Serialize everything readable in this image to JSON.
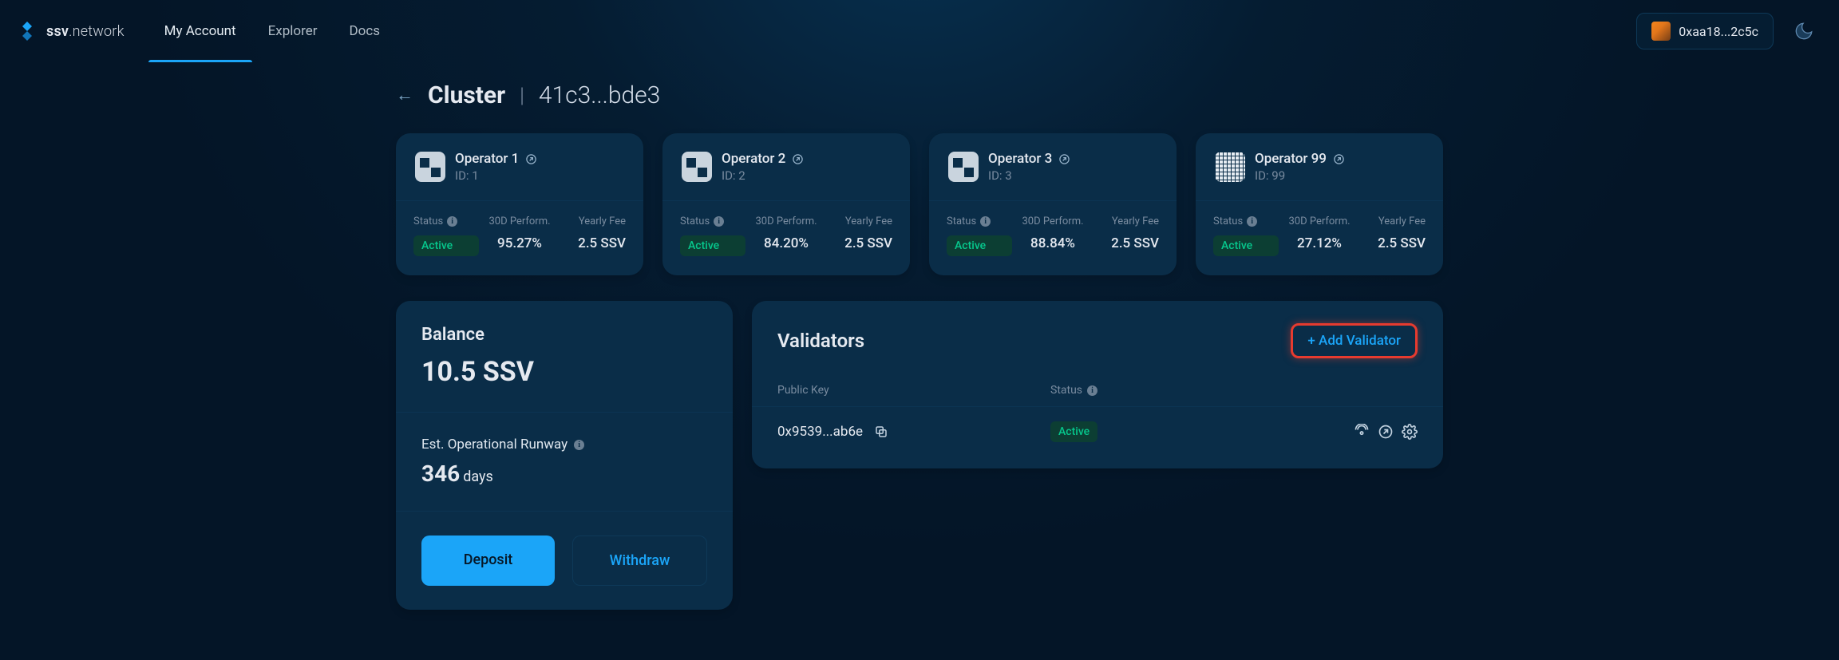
{
  "header": {
    "logo_text_bold": "ssv",
    "logo_text_thin": ".network",
    "nav": [
      {
        "label": "My Account",
        "active": true
      },
      {
        "label": "Explorer",
        "active": false
      },
      {
        "label": "Docs",
        "active": false
      }
    ],
    "account_address": "0xaa18...2c5c"
  },
  "breadcrumb": {
    "title": "Cluster",
    "id": "41c3...bde3"
  },
  "labels": {
    "status": "Status",
    "perf_30d": "30D Perform.",
    "yearly_fee": "Yearly Fee",
    "id_prefix": "ID:",
    "balance_title": "Balance",
    "runway_label": "Est. Operational Runway",
    "days": "days",
    "deposit": "Deposit",
    "withdraw": "Withdraw",
    "validators_title": "Validators",
    "add_validator": "+ Add Validator",
    "public_key": "Public Key"
  },
  "operators": [
    {
      "name": "Operator 1",
      "id": "1",
      "status": "Active",
      "perf": "95.27%",
      "fee": "2.5 SSV",
      "avatar": "std"
    },
    {
      "name": "Operator 2",
      "id": "2",
      "status": "Active",
      "perf": "84.20%",
      "fee": "2.5 SSV",
      "avatar": "std"
    },
    {
      "name": "Operator 3",
      "id": "3",
      "status": "Active",
      "perf": "88.84%",
      "fee": "2.5 SSV",
      "avatar": "std"
    },
    {
      "name": "Operator 99",
      "id": "99",
      "status": "Active",
      "perf": "27.12%",
      "fee": "2.5 SSV",
      "avatar": "qr"
    }
  ],
  "balance": {
    "amount": "10.5 SSV",
    "runway_value": "346"
  },
  "validators": [
    {
      "public_key": "0x9539...ab6e",
      "status": "Active"
    }
  ]
}
